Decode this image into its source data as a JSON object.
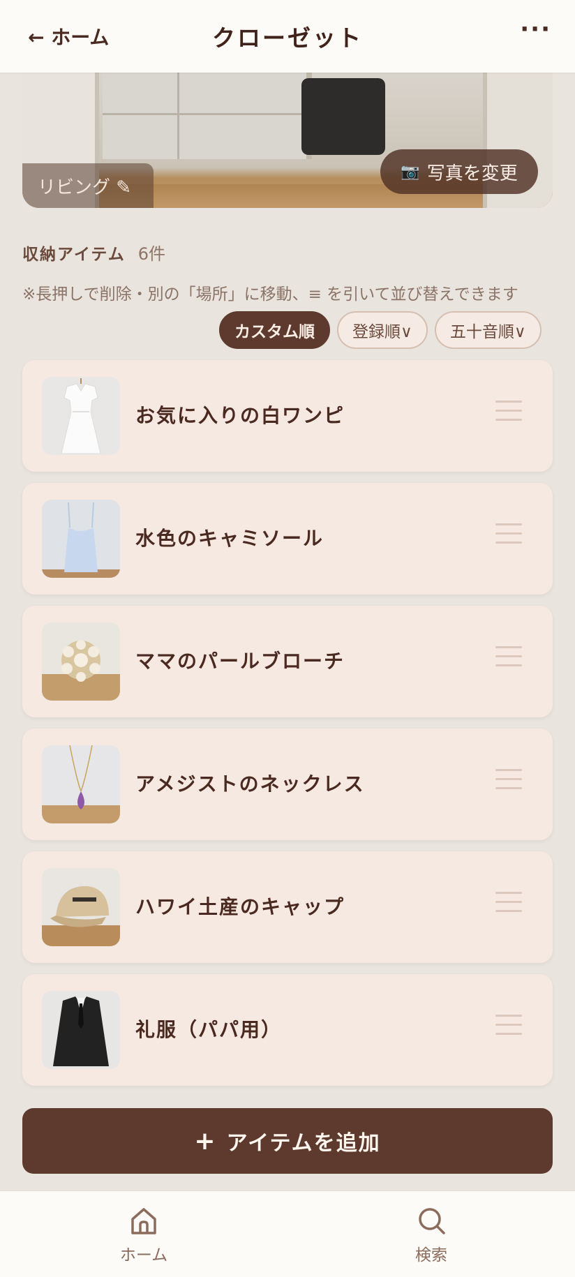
{
  "header": {
    "back_label": "← ホーム",
    "title": "クローゼット",
    "more_label": "···"
  },
  "hero": {
    "location_label": "リビング ✎",
    "change_photo_label": "写真を変更",
    "camera_icon": "📷"
  },
  "section": {
    "title": "収納アイテム",
    "count": "6件",
    "hint": "※長押しで削除・別の「場所」に移動、≡ を引いて並び替えできます"
  },
  "sort": {
    "options": [
      "カスタム順",
      "登録順∨",
      "五十音順∨"
    ],
    "active": "カスタム順"
  },
  "items": [
    {
      "name": "お気に入りの白ワンピ",
      "thumb": "white-dress"
    },
    {
      "name": "水色のキャミソール",
      "thumb": "blue-camisole"
    },
    {
      "name": "ママのパールブローチ",
      "thumb": "pearl-brooch"
    },
    {
      "name": "アメジストのネックレス",
      "thumb": "amethyst-necklace"
    },
    {
      "name": "ハワイ土産のキャップ",
      "thumb": "beige-cap"
    },
    {
      "name": "礼服（パパ用）",
      "thumb": "black-suit"
    }
  ],
  "add_button": {
    "plus": "+",
    "label": "アイテムを追加"
  },
  "bottom_nav": [
    {
      "label": "ホーム",
      "icon": "home-icon"
    },
    {
      "label": "検索",
      "icon": "search-icon"
    }
  ],
  "colors": {
    "primary": "#5d3a2d",
    "background": "#e9e4de",
    "card": "#f6e9e1",
    "text": "#4a2a20"
  }
}
